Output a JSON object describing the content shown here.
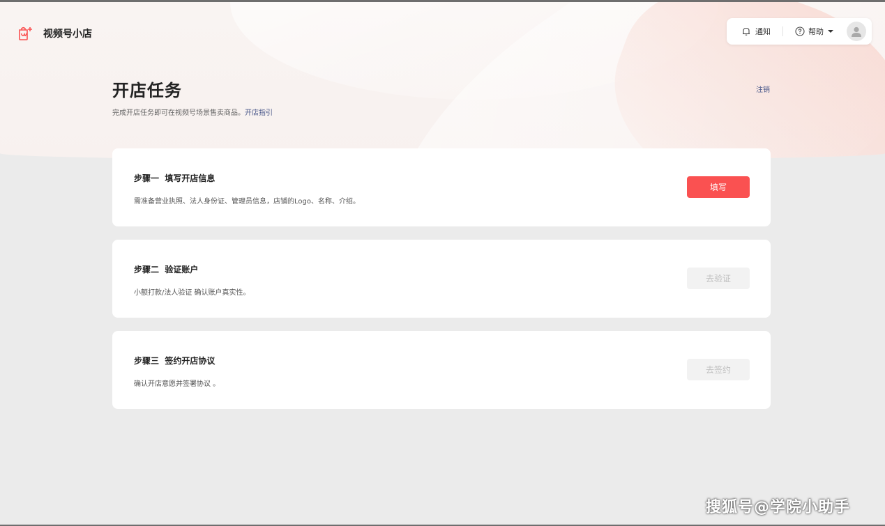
{
  "app": {
    "name": "视频号小店"
  },
  "topbar": {
    "notify_label": "通知",
    "help_label": "帮助"
  },
  "page": {
    "title": "开店任务",
    "subtitle": "完成开店任务即可在视频号场景售卖商品。",
    "guide_link": "开店指引",
    "logout": "注销"
  },
  "steps": [
    {
      "title": "步骤一  填写开店信息",
      "desc": "需准备营业执照、法人身份证、管理员信息，店铺的Logo、名称、介绍。",
      "button": "填写",
      "enabled": true
    },
    {
      "title": "步骤二  验证账户",
      "desc": "小额打款/法人验证 确认账户真实性。",
      "button": "去验证",
      "enabled": false
    },
    {
      "title": "步骤三  签约开店协议",
      "desc": "确认开店意愿并签署协议 。",
      "button": "去签约",
      "enabled": false
    }
  ],
  "watermark": "搜狐号@学院小助手",
  "colors": {
    "accent": "#fa5151",
    "link": "#4d5b8c",
    "background": "#ebebeb"
  },
  "icons": {
    "logo": "shop-bag-icon",
    "notify": "bell-icon",
    "help": "help-circle-icon",
    "avatar": "user-avatar-icon"
  }
}
